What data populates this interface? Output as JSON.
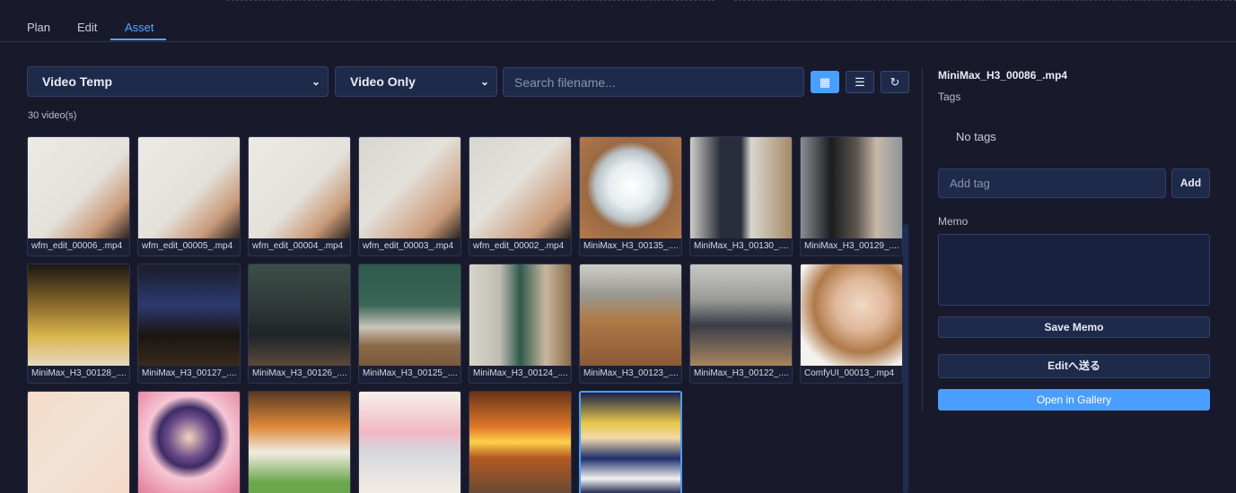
{
  "tabs": [
    {
      "label": "Plan",
      "active": false
    },
    {
      "label": "Edit",
      "active": false
    },
    {
      "label": "Asset",
      "active": true
    }
  ],
  "toolbar": {
    "folder_select": "Video Temp",
    "type_select": "Video Only",
    "search_placeholder": "Search filename...",
    "grid_icon": "grid-view-icon",
    "list_icon": "list-view-icon",
    "refresh_icon": "refresh-icon",
    "grid_glyph": "▦",
    "list_glyph": "☰",
    "refresh_glyph": "↻"
  },
  "count_label": "30 video(s)",
  "videos": [
    {
      "name": "wfm_edit_00006_.mp4"
    },
    {
      "name": "wfm_edit_00005_.mp4"
    },
    {
      "name": "wfm_edit_00004_.mp4"
    },
    {
      "name": "wfm_edit_00003_.mp4"
    },
    {
      "name": "wfm_edit_00002_.mp4"
    },
    {
      "name": "MiniMax_H3_00135_...."
    },
    {
      "name": "MiniMax_H3_00130_...."
    },
    {
      "name": "MiniMax_H3_00129_...."
    },
    {
      "name": "MiniMax_H3_00128_...."
    },
    {
      "name": "MiniMax_H3_00127_...."
    },
    {
      "name": "MiniMax_H3_00126_...."
    },
    {
      "name": "MiniMax_H3_00125_...."
    },
    {
      "name": "MiniMax_H3_00124_...."
    },
    {
      "name": "MiniMax_H3_00123_...."
    },
    {
      "name": "MiniMax_H3_00122_...."
    },
    {
      "name": "ComfyUI_00013_.mp4"
    },
    {
      "name": ""
    },
    {
      "name": ""
    },
    {
      "name": ""
    },
    {
      "name": ""
    },
    {
      "name": ""
    },
    {
      "name": ""
    }
  ],
  "details": {
    "title": "MiniMax_H3_00086_.mp4",
    "tags_label": "Tags",
    "no_tags": "No tags",
    "add_tag_placeholder": "Add tag",
    "add_button": "Add",
    "memo_label": "Memo",
    "save_memo_button": "Save Memo",
    "send_to_edit_button": "Editへ送る",
    "open_gallery_button": "Open in Gallery"
  },
  "colors": {
    "accent": "#4a9eff",
    "background": "#181a2c",
    "panel": "#1e2a4a"
  }
}
